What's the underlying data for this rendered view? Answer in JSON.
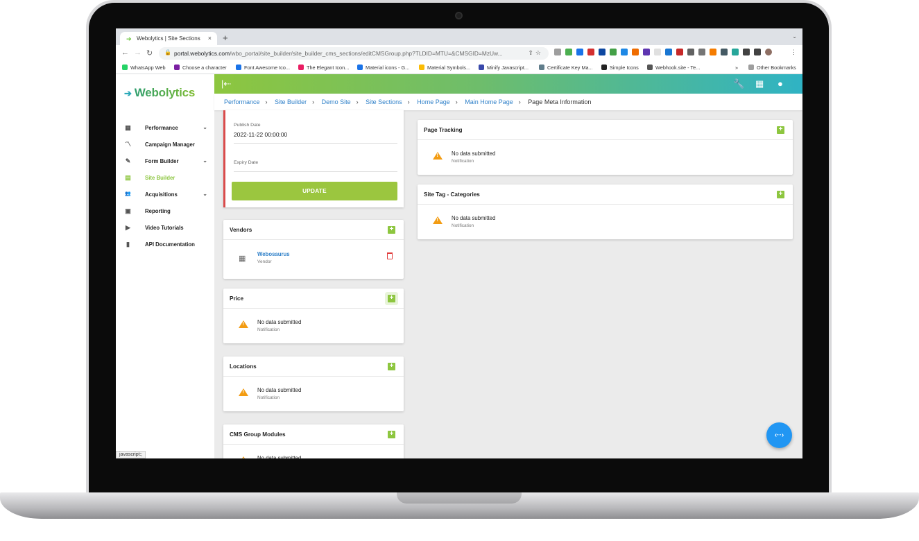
{
  "browser": {
    "tab_title": "Webolytics | Site Sections",
    "tab_close": "×",
    "new_tab": "+",
    "tabs_menu": "⌄",
    "url_host": "portal.webolytics.com",
    "url_path": "/wbo_portal/site_builder/site_builder_cms_sections/editCMSGroup.php?TLDID=MTU=&CMSGID=MzUw...",
    "bookmarks": [
      {
        "label": "WhatsApp Web",
        "color": "#25d366"
      },
      {
        "label": "Choose a character",
        "color": "#7b1fa2"
      },
      {
        "label": "Font Awesome Ico...",
        "color": "#1a73e8"
      },
      {
        "label": "The Elegant Icon...",
        "color": "#e91e63"
      },
      {
        "label": "Material icons - G...",
        "color": "#1a73e8"
      },
      {
        "label": "Material Symbols...",
        "color": "#fbbc04"
      },
      {
        "label": "Minify Javascript...",
        "color": "#3949ab"
      },
      {
        "label": "Certificate Key Ma...",
        "color": "#607d8b"
      },
      {
        "label": "Simple Icons",
        "color": "#222222"
      },
      {
        "label": "Webhook.site - Te...",
        "color": "#555555"
      }
    ],
    "more_bookmarks": "»",
    "other_bookmarks": "Other Bookmarks",
    "status_text": "javascript:;"
  },
  "app": {
    "logo": "Webolytics",
    "sidebar": [
      {
        "label": "Performance",
        "icon": "dashboard-icon",
        "glyph": "▦",
        "chevron": true
      },
      {
        "label": "Campaign Manager",
        "icon": "trending-icon",
        "glyph": "〽",
        "chevron": false
      },
      {
        "label": "Form Builder",
        "icon": "edit-note-icon",
        "glyph": "✎",
        "chevron": true
      },
      {
        "label": "Site Builder",
        "icon": "web-icon",
        "glyph": "▤",
        "chevron": false,
        "active": true
      },
      {
        "label": "Acquisitions",
        "icon": "people-icon",
        "glyph": "👥",
        "chevron": true
      },
      {
        "label": "Reporting",
        "icon": "report-icon",
        "glyph": "▣",
        "chevron": false
      },
      {
        "label": "Video Tutorials",
        "icon": "video-library-icon",
        "glyph": "▶",
        "chevron": false
      },
      {
        "label": "API Documentation",
        "icon": "book-icon",
        "glyph": "▮",
        "chevron": false
      }
    ],
    "breadcrumbs": [
      "Performance",
      "Site Builder",
      "Demo Site",
      "Site Sections",
      "Home Page",
      "Main Home Page"
    ],
    "breadcrumb_current": "Page Meta Information",
    "form": {
      "publish_label": "Publish Date",
      "publish_value": "2022-11-22 00:00:00",
      "expiry_label": "Expiry Date",
      "update_label": "UPDATE"
    },
    "vendors": {
      "title": "Vendors",
      "name": "Webosaurus",
      "sub": "Vendor"
    },
    "price": {
      "title": "Price"
    },
    "locations": {
      "title": "Locations"
    },
    "cms_modules": {
      "title": "CMS Group Modules"
    },
    "page_tracking": {
      "title": "Page Tracking"
    },
    "site_tag": {
      "title": "Site Tag - Categories"
    },
    "no_data": {
      "title": "No data submitted",
      "sub": "Notification"
    },
    "fab_label": "‹··›",
    "colors": {
      "accent": "#8dc63f",
      "link": "#2f80c9",
      "warning": "#f39c12",
      "danger": "#e03c3c",
      "fab": "#2196f3"
    }
  }
}
